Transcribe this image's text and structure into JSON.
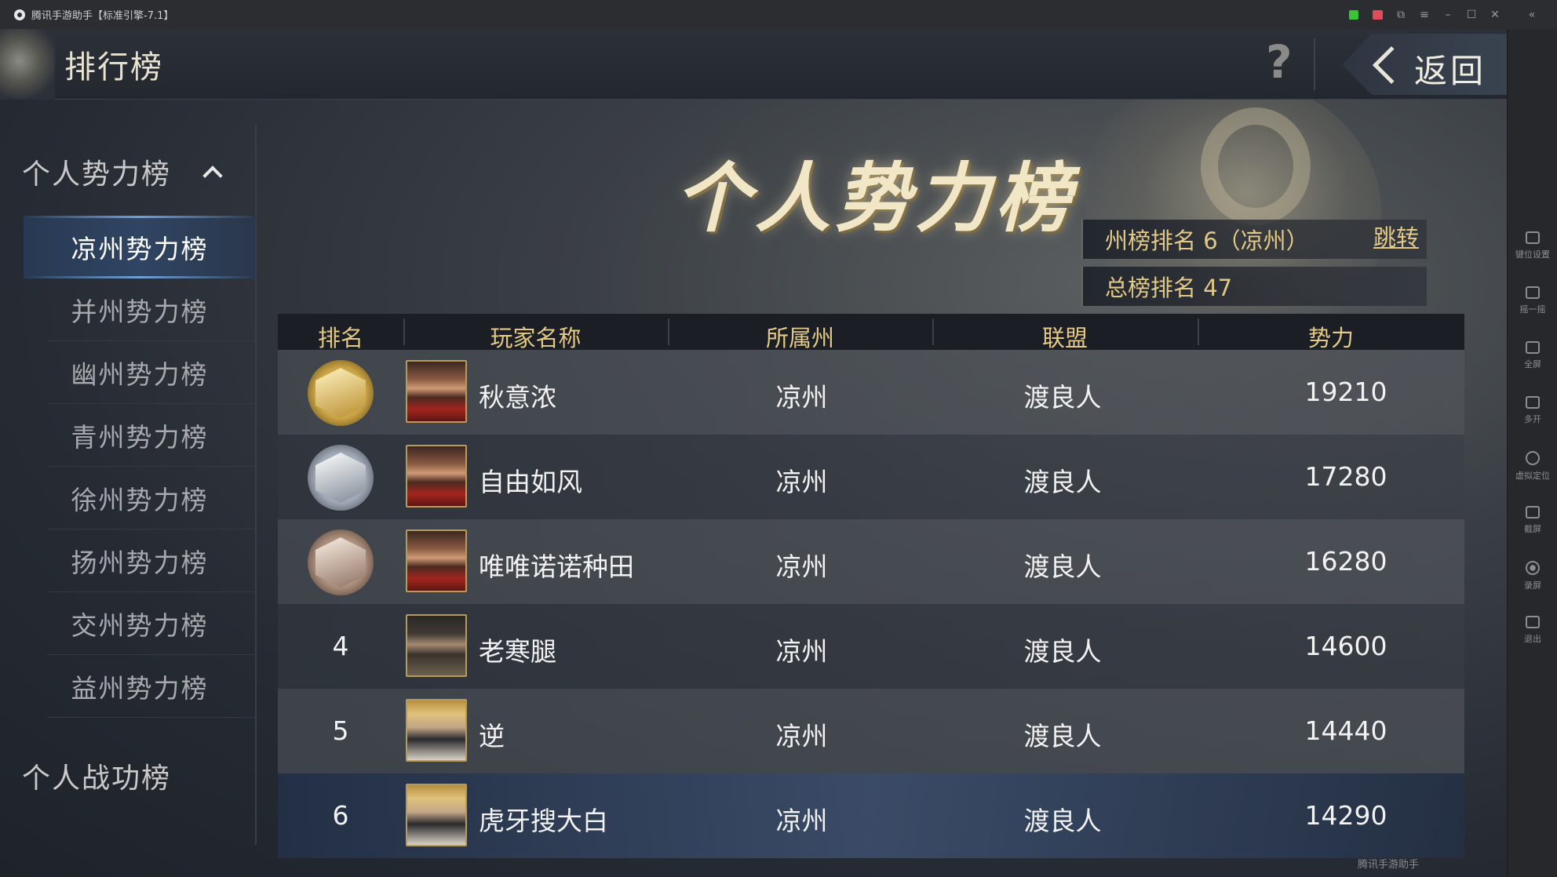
{
  "window": {
    "title": "腾讯手游助手【标准引擎-7.1】",
    "watermark": "腾讯手游助手"
  },
  "header": {
    "title": "排行榜",
    "help_label": "?",
    "back_label": "返回"
  },
  "sidebar": {
    "group1": "个人势力榜",
    "items": [
      {
        "label": "凉州势力榜",
        "active": true
      },
      {
        "label": "并州势力榜",
        "active": false
      },
      {
        "label": "幽州势力榜",
        "active": false
      },
      {
        "label": "青州势力榜",
        "active": false
      },
      {
        "label": "徐州势力榜",
        "active": false
      },
      {
        "label": "扬州势力榜",
        "active": false
      },
      {
        "label": "交州势力榜",
        "active": false
      },
      {
        "label": "益州势力榜",
        "active": false
      }
    ],
    "group2": "个人战功榜"
  },
  "banner": {
    "title": "个人势力榜",
    "state_rank": "州榜排名 6（凉州）",
    "jump_label": "跳转",
    "total_rank": "总榜排名 47"
  },
  "table": {
    "columns": [
      "排名",
      "玩家名称",
      "所属州",
      "联盟",
      "势力"
    ],
    "rows": [
      {
        "rank": "1",
        "medal": "gold",
        "avatar": "red",
        "name": "秋意浓",
        "region": "凉州",
        "alliance": "渡良人",
        "power": "19210"
      },
      {
        "rank": "2",
        "medal": "silver",
        "avatar": "red",
        "name": "自由如风",
        "region": "凉州",
        "alliance": "渡良人",
        "power": "17280"
      },
      {
        "rank": "3",
        "medal": "bronze",
        "avatar": "red",
        "name": "唯唯诺诺种田",
        "region": "凉州",
        "alliance": "渡良人",
        "power": "16280"
      },
      {
        "rank": "4",
        "medal": "",
        "avatar": "dark",
        "name": "老寒腿",
        "region": "凉州",
        "alliance": "渡良人",
        "power": "14600"
      },
      {
        "rank": "5",
        "medal": "",
        "avatar": "gold",
        "name": "逆",
        "region": "凉州",
        "alliance": "渡良人",
        "power": "14440"
      },
      {
        "rank": "6",
        "medal": "",
        "avatar": "gold",
        "name": "虎牙搜大白",
        "region": "凉州",
        "alliance": "渡良人",
        "power": "14290"
      }
    ]
  },
  "side_tools": [
    {
      "icon": "keyboard-icon",
      "label": "键位设置"
    },
    {
      "icon": "shake-icon",
      "label": "摇一摇"
    },
    {
      "icon": "fullscreen-icon",
      "label": "全屏"
    },
    {
      "icon": "multi-instance-icon",
      "label": "多开"
    },
    {
      "icon": "location-icon",
      "label": "虚拟定位"
    },
    {
      "icon": "screenshot-icon",
      "label": "截屏"
    },
    {
      "icon": "record-icon",
      "label": "录屏"
    },
    {
      "icon": "exit-icon",
      "label": "退出"
    }
  ],
  "colors": {
    "gold_text": "#e3c986",
    "active_nav": "#304666",
    "title_bar": "#2b2d31"
  }
}
